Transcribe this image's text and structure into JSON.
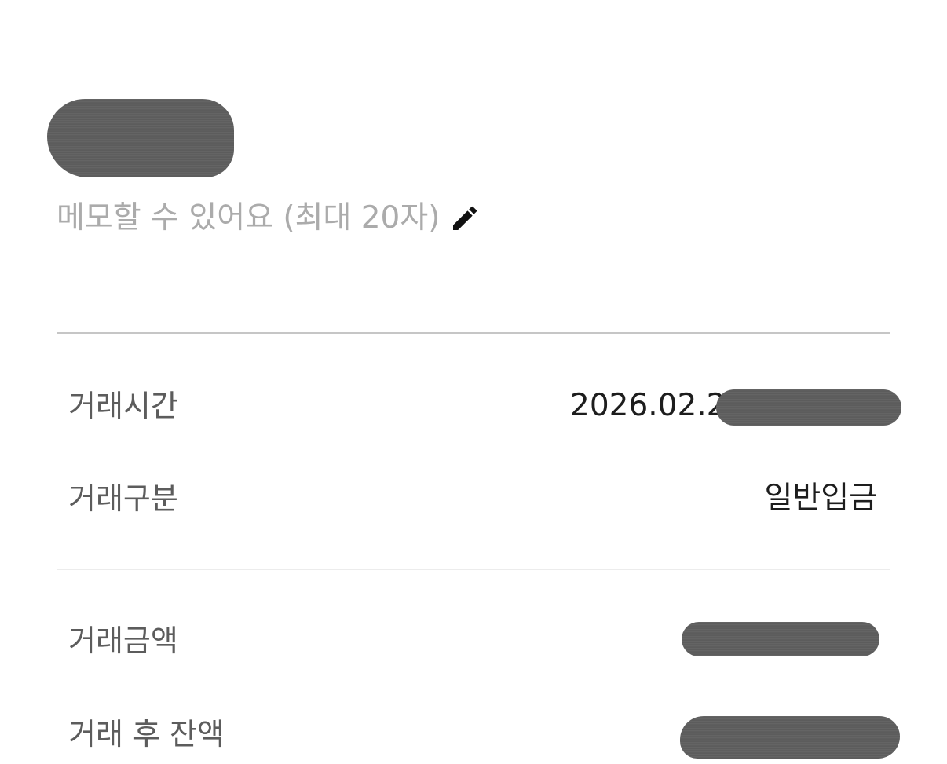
{
  "memo": {
    "placeholder": "메모할 수 있어요 (최대 20자)",
    "edit_icon": "pencil-icon"
  },
  "details": {
    "time_label": "거래시간",
    "time_value": "2026.02.2",
    "type_label": "거래구분",
    "type_value": "일반입금",
    "amount_label": "거래금액",
    "balance_label": "거래 후 잔액"
  },
  "colors": {
    "placeholder": "#ababab",
    "label": "#5c5c5c",
    "value": "#1d1d1d",
    "divider": "#c6c6c6"
  }
}
